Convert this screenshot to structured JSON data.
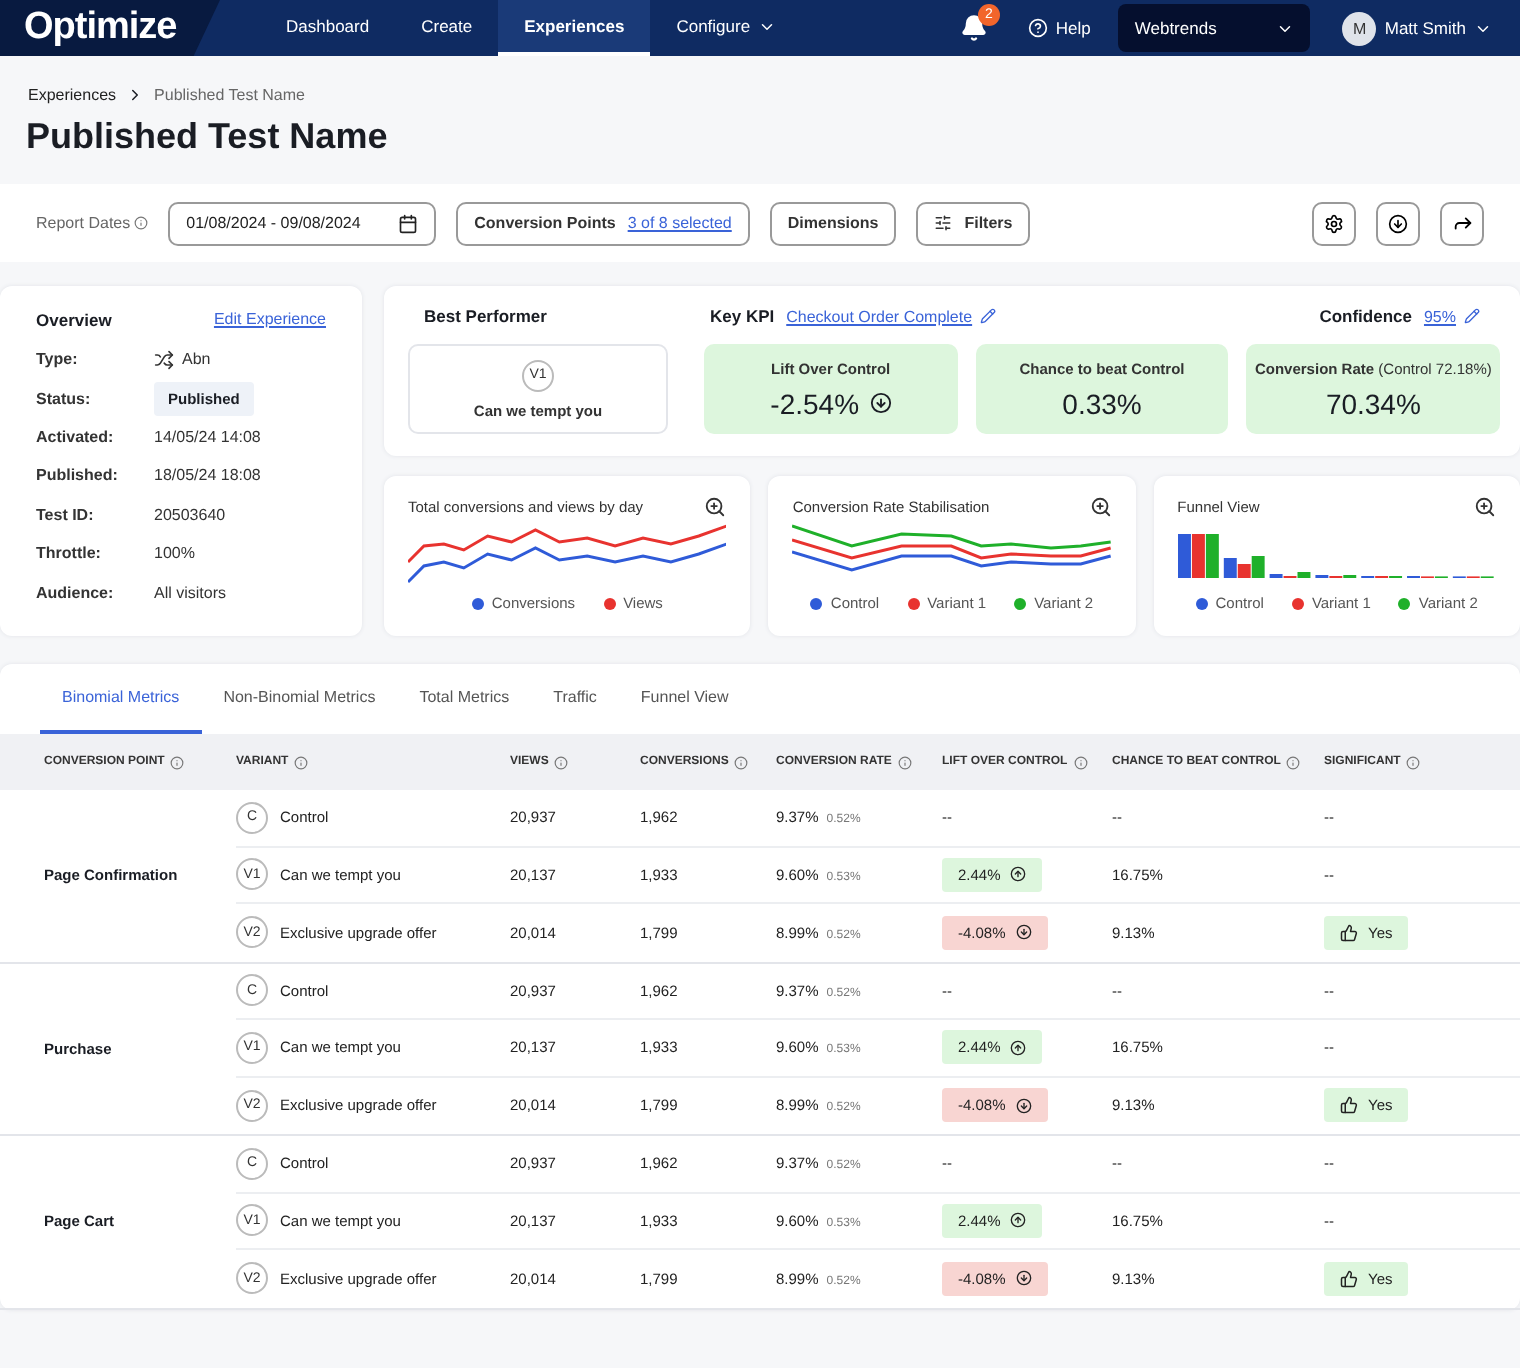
{
  "nav": {
    "logo": "Optimize",
    "items": [
      {
        "label": "Dashboard",
        "selected": false,
        "menu": false
      },
      {
        "label": "Create",
        "selected": false,
        "menu": false
      },
      {
        "label": "Experiences",
        "selected": true,
        "menu": false
      },
      {
        "label": "Configure",
        "selected": false,
        "menu": true
      }
    ],
    "notifications": "2",
    "help": "Help",
    "account": "Webtrends",
    "user": {
      "initial": "M",
      "name": "Matt Smith"
    }
  },
  "breadcrumb": [
    "Experiences",
    "Published Test Name"
  ],
  "title": "Published Test Name",
  "toolbar": {
    "dates_label": "Report Dates",
    "dates": "01/08/2024 - 09/08/2024",
    "conversion_points": {
      "label": "Conversion Points",
      "link": "3 of 8 selected"
    },
    "dimensions": "Dimensions",
    "filters": "Filters"
  },
  "overview": {
    "title": "Overview",
    "edit": "Edit Experience",
    "fields": [
      {
        "label": "Type:",
        "value": "Abn",
        "kind": "type"
      },
      {
        "label": "Status:",
        "value": "Published",
        "kind": "status"
      },
      {
        "label": "Activated:",
        "value": "14/05/24 14:08",
        "kind": "text"
      },
      {
        "label": "Published:",
        "value": "18/05/24 18:08",
        "kind": "text"
      },
      {
        "label": "Test ID:",
        "value": "20503640",
        "kind": "text"
      },
      {
        "label": "Throttle:",
        "value": "100%",
        "kind": "text"
      },
      {
        "label": "Audience:",
        "value": "All visitors",
        "kind": "text"
      }
    ]
  },
  "summary": {
    "best_performer": {
      "title": "Best Performer",
      "badge": "V1",
      "name": "Can we tempt you"
    },
    "key_kpi": {
      "label": "Key KPI",
      "value": "Checkout Order Complete"
    },
    "confidence": {
      "label": "Confidence",
      "value": "95%"
    },
    "tiles": [
      {
        "label": "Lift Over Control",
        "value": "-2.54%",
        "kind": "negative"
      },
      {
        "label": "Chance to beat Control",
        "value": "0.33%",
        "kind": "plain"
      },
      {
        "label": "Conversion Rate",
        "note": "(Control 72.18%)",
        "value": "70.34%",
        "kind": "plain"
      }
    ]
  },
  "charts": [
    {
      "title": "Total conversions and views by day",
      "kind": "lines2",
      "legend": [
        {
          "label": "Conversions",
          "color": "#2f5bd8"
        },
        {
          "label": "Views",
          "color": "#e8332f"
        }
      ]
    },
    {
      "title": "Conversion Rate Stabilisation",
      "kind": "lines3",
      "legend": [
        {
          "label": "Control",
          "color": "#2f5bd8"
        },
        {
          "label": "Variant 1",
          "color": "#e8332f"
        },
        {
          "label": "Variant 2",
          "color": "#1fb02a"
        }
      ]
    },
    {
      "title": "Funnel View",
      "kind": "funnel",
      "legend": [
        {
          "label": "Control",
          "color": "#2f5bd8"
        },
        {
          "label": "Variant 1",
          "color": "#e8332f"
        },
        {
          "label": "Variant 2",
          "color": "#1fb02a"
        }
      ]
    }
  ],
  "tabs": [
    {
      "label": "Binomial Metrics",
      "selected": true
    },
    {
      "label": "Non-Binomial Metrics",
      "selected": false
    },
    {
      "label": "Total Metrics",
      "selected": false
    },
    {
      "label": "Traffic",
      "selected": false
    },
    {
      "label": "Funnel View",
      "selected": false
    }
  ],
  "table": {
    "columns": [
      "CONVERSION POINT",
      "VARIANT",
      "VIEWS",
      "CONVERSIONS",
      "CONVERSION RATE",
      "LIFT OVER CONTROL",
      "CHANCE TO BEAT CONTROL",
      "SIGNIFICANT"
    ],
    "groups": [
      {
        "name": "Page Confirmation",
        "rows": [
          {
            "badge": "C",
            "variant": "Control",
            "views": "20,937",
            "conversions": "1,962",
            "rate": "9.37%",
            "rate_error": "0.52%",
            "lift": {
              "text": "--",
              "kind": "none"
            },
            "chance": "--",
            "significant": {
              "text": "--",
              "kind": "plain"
            }
          },
          {
            "badge": "V1",
            "variant": "Can we tempt you",
            "views": "20,137",
            "conversions": "1,933",
            "rate": "9.60%",
            "rate_error": "0.53%",
            "lift": {
              "text": "2.44%",
              "kind": "positive"
            },
            "chance": "16.75%",
            "significant": {
              "text": "--",
              "kind": "plain"
            }
          },
          {
            "badge": "V2",
            "variant": "Exclusive upgrade offer",
            "views": "20,014",
            "conversions": "1,799",
            "rate": "8.99%",
            "rate_error": "0.52%",
            "lift": {
              "text": "-4.08%",
              "kind": "negative"
            },
            "chance": "9.13%",
            "significant": {
              "text": "Yes",
              "kind": "badge"
            }
          }
        ]
      },
      {
        "name": "Purchase",
        "rows": [
          {
            "badge": "C",
            "variant": "Control",
            "views": "20,937",
            "conversions": "1,962",
            "rate": "9.37%",
            "rate_error": "0.52%",
            "lift": {
              "text": "--",
              "kind": "none"
            },
            "chance": "--",
            "significant": {
              "text": "--",
              "kind": "plain"
            }
          },
          {
            "badge": "V1",
            "variant": "Can we tempt you",
            "views": "20,137",
            "conversions": "1,933",
            "rate": "9.60%",
            "rate_error": "0.53%",
            "lift": {
              "text": "2.44%",
              "kind": "positive"
            },
            "chance": "16.75%",
            "significant": {
              "text": "--",
              "kind": "plain"
            }
          },
          {
            "badge": "V2",
            "variant": "Exclusive upgrade offer",
            "views": "20,014",
            "conversions": "1,799",
            "rate": "8.99%",
            "rate_error": "0.52%",
            "lift": {
              "text": "-4.08%",
              "kind": "negative"
            },
            "chance": "9.13%",
            "significant": {
              "text": "Yes",
              "kind": "badge"
            }
          }
        ]
      },
      {
        "name": "Page Cart",
        "rows": [
          {
            "badge": "C",
            "variant": "Control",
            "views": "20,937",
            "conversions": "1,962",
            "rate": "9.37%",
            "rate_error": "0.52%",
            "lift": {
              "text": "--",
              "kind": "none"
            },
            "chance": "--",
            "significant": {
              "text": "--",
              "kind": "plain"
            }
          },
          {
            "badge": "V1",
            "variant": "Can we tempt you",
            "views": "20,137",
            "conversions": "1,933",
            "rate": "9.60%",
            "rate_error": "0.53%",
            "lift": {
              "text": "2.44%",
              "kind": "positive"
            },
            "chance": "16.75%",
            "significant": {
              "text": "--",
              "kind": "plain"
            }
          },
          {
            "badge": "V2",
            "variant": "Exclusive upgrade offer",
            "views": "20,014",
            "conversions": "1,799",
            "rate": "8.99%",
            "rate_error": "0.52%",
            "lift": {
              "text": "-4.08%",
              "kind": "negative"
            },
            "chance": "9.13%",
            "significant": {
              "text": "Yes",
              "kind": "badge"
            }
          }
        ]
      }
    ]
  }
}
